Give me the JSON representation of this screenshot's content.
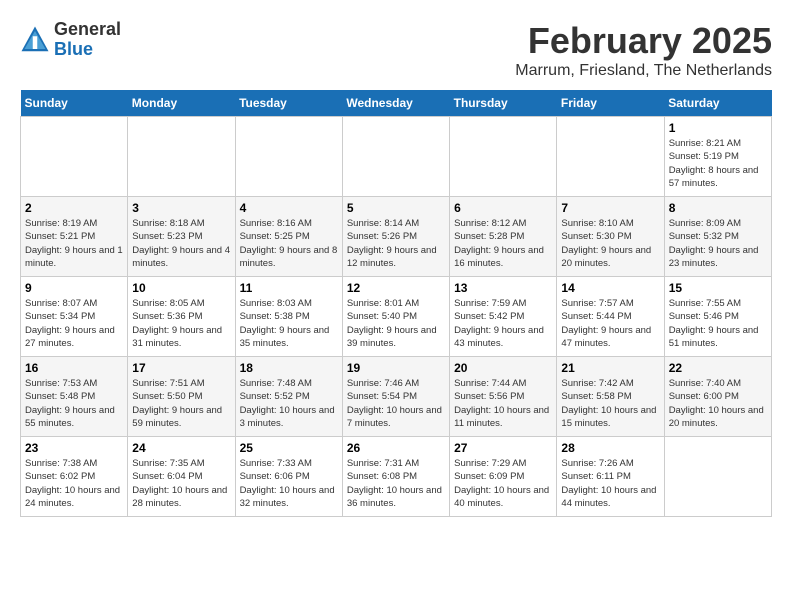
{
  "header": {
    "logo": {
      "line1": "General",
      "line2": "Blue"
    },
    "title": "February 2025",
    "location": "Marrum, Friesland, The Netherlands"
  },
  "columns": [
    "Sunday",
    "Monday",
    "Tuesday",
    "Wednesday",
    "Thursday",
    "Friday",
    "Saturday"
  ],
  "weeks": [
    [
      {
        "day": "",
        "sunrise": "",
        "sunset": "",
        "daylight": ""
      },
      {
        "day": "",
        "sunrise": "",
        "sunset": "",
        "daylight": ""
      },
      {
        "day": "",
        "sunrise": "",
        "sunset": "",
        "daylight": ""
      },
      {
        "day": "",
        "sunrise": "",
        "sunset": "",
        "daylight": ""
      },
      {
        "day": "",
        "sunrise": "",
        "sunset": "",
        "daylight": ""
      },
      {
        "day": "",
        "sunrise": "",
        "sunset": "",
        "daylight": ""
      },
      {
        "day": "1",
        "sunrise": "Sunrise: 8:21 AM",
        "sunset": "Sunset: 5:19 PM",
        "daylight": "Daylight: 8 hours and 57 minutes."
      }
    ],
    [
      {
        "day": "2",
        "sunrise": "Sunrise: 8:19 AM",
        "sunset": "Sunset: 5:21 PM",
        "daylight": "Daylight: 9 hours and 1 minute."
      },
      {
        "day": "3",
        "sunrise": "Sunrise: 8:18 AM",
        "sunset": "Sunset: 5:23 PM",
        "daylight": "Daylight: 9 hours and 4 minutes."
      },
      {
        "day": "4",
        "sunrise": "Sunrise: 8:16 AM",
        "sunset": "Sunset: 5:25 PM",
        "daylight": "Daylight: 9 hours and 8 minutes."
      },
      {
        "day": "5",
        "sunrise": "Sunrise: 8:14 AM",
        "sunset": "Sunset: 5:26 PM",
        "daylight": "Daylight: 9 hours and 12 minutes."
      },
      {
        "day": "6",
        "sunrise": "Sunrise: 8:12 AM",
        "sunset": "Sunset: 5:28 PM",
        "daylight": "Daylight: 9 hours and 16 minutes."
      },
      {
        "day": "7",
        "sunrise": "Sunrise: 8:10 AM",
        "sunset": "Sunset: 5:30 PM",
        "daylight": "Daylight: 9 hours and 20 minutes."
      },
      {
        "day": "8",
        "sunrise": "Sunrise: 8:09 AM",
        "sunset": "Sunset: 5:32 PM",
        "daylight": "Daylight: 9 hours and 23 minutes."
      }
    ],
    [
      {
        "day": "9",
        "sunrise": "Sunrise: 8:07 AM",
        "sunset": "Sunset: 5:34 PM",
        "daylight": "Daylight: 9 hours and 27 minutes."
      },
      {
        "day": "10",
        "sunrise": "Sunrise: 8:05 AM",
        "sunset": "Sunset: 5:36 PM",
        "daylight": "Daylight: 9 hours and 31 minutes."
      },
      {
        "day": "11",
        "sunrise": "Sunrise: 8:03 AM",
        "sunset": "Sunset: 5:38 PM",
        "daylight": "Daylight: 9 hours and 35 minutes."
      },
      {
        "day": "12",
        "sunrise": "Sunrise: 8:01 AM",
        "sunset": "Sunset: 5:40 PM",
        "daylight": "Daylight: 9 hours and 39 minutes."
      },
      {
        "day": "13",
        "sunrise": "Sunrise: 7:59 AM",
        "sunset": "Sunset: 5:42 PM",
        "daylight": "Daylight: 9 hours and 43 minutes."
      },
      {
        "day": "14",
        "sunrise": "Sunrise: 7:57 AM",
        "sunset": "Sunset: 5:44 PM",
        "daylight": "Daylight: 9 hours and 47 minutes."
      },
      {
        "day": "15",
        "sunrise": "Sunrise: 7:55 AM",
        "sunset": "Sunset: 5:46 PM",
        "daylight": "Daylight: 9 hours and 51 minutes."
      }
    ],
    [
      {
        "day": "16",
        "sunrise": "Sunrise: 7:53 AM",
        "sunset": "Sunset: 5:48 PM",
        "daylight": "Daylight: 9 hours and 55 minutes."
      },
      {
        "day": "17",
        "sunrise": "Sunrise: 7:51 AM",
        "sunset": "Sunset: 5:50 PM",
        "daylight": "Daylight: 9 hours and 59 minutes."
      },
      {
        "day": "18",
        "sunrise": "Sunrise: 7:48 AM",
        "sunset": "Sunset: 5:52 PM",
        "daylight": "Daylight: 10 hours and 3 minutes."
      },
      {
        "day": "19",
        "sunrise": "Sunrise: 7:46 AM",
        "sunset": "Sunset: 5:54 PM",
        "daylight": "Daylight: 10 hours and 7 minutes."
      },
      {
        "day": "20",
        "sunrise": "Sunrise: 7:44 AM",
        "sunset": "Sunset: 5:56 PM",
        "daylight": "Daylight: 10 hours and 11 minutes."
      },
      {
        "day": "21",
        "sunrise": "Sunrise: 7:42 AM",
        "sunset": "Sunset: 5:58 PM",
        "daylight": "Daylight: 10 hours and 15 minutes."
      },
      {
        "day": "22",
        "sunrise": "Sunrise: 7:40 AM",
        "sunset": "Sunset: 6:00 PM",
        "daylight": "Daylight: 10 hours and 20 minutes."
      }
    ],
    [
      {
        "day": "23",
        "sunrise": "Sunrise: 7:38 AM",
        "sunset": "Sunset: 6:02 PM",
        "daylight": "Daylight: 10 hours and 24 minutes."
      },
      {
        "day": "24",
        "sunrise": "Sunrise: 7:35 AM",
        "sunset": "Sunset: 6:04 PM",
        "daylight": "Daylight: 10 hours and 28 minutes."
      },
      {
        "day": "25",
        "sunrise": "Sunrise: 7:33 AM",
        "sunset": "Sunset: 6:06 PM",
        "daylight": "Daylight: 10 hours and 32 minutes."
      },
      {
        "day": "26",
        "sunrise": "Sunrise: 7:31 AM",
        "sunset": "Sunset: 6:08 PM",
        "daylight": "Daylight: 10 hours and 36 minutes."
      },
      {
        "day": "27",
        "sunrise": "Sunrise: 7:29 AM",
        "sunset": "Sunset: 6:09 PM",
        "daylight": "Daylight: 10 hours and 40 minutes."
      },
      {
        "day": "28",
        "sunrise": "Sunrise: 7:26 AM",
        "sunset": "Sunset: 6:11 PM",
        "daylight": "Daylight: 10 hours and 44 minutes."
      },
      {
        "day": "",
        "sunrise": "",
        "sunset": "",
        "daylight": ""
      }
    ]
  ]
}
